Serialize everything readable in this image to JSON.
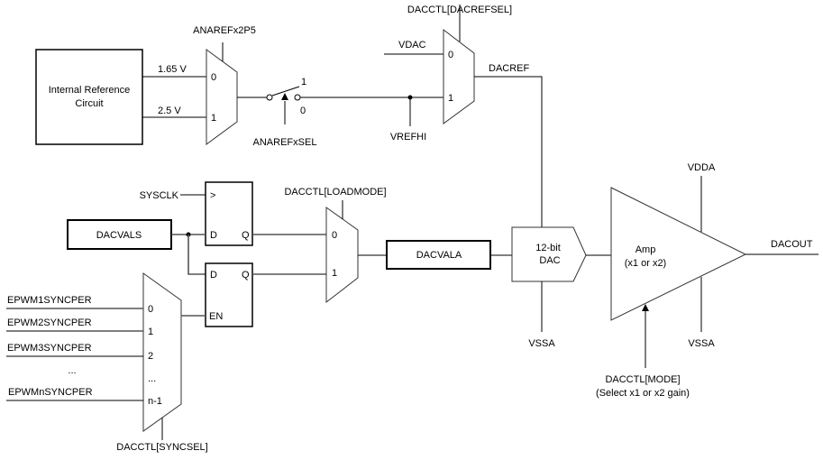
{
  "diagram": {
    "internal_ref": {
      "line1": "Internal Reference",
      "line2": "Circuit"
    },
    "ref_mux": {
      "control": "ANAREFx2P5",
      "in0_label": "1.65 V",
      "in1_label": "2.5 V",
      "port0": "0",
      "port1": "1"
    },
    "ref_switch": {
      "control": "ANAREFxSEL",
      "pos1": "1",
      "pos0": "0"
    },
    "vrefhi": "VREFHI",
    "dacref_mux": {
      "control": "DACCTL[DACREFSEL]",
      "in0_label": "VDAC",
      "port0": "0",
      "port1": "1",
      "output": "DACREF"
    },
    "sysclk": "SYSCLK",
    "dacvals": "DACVALS",
    "ff1": {
      "clk": ">",
      "d": "D",
      "q": "Q"
    },
    "ff2": {
      "d": "D",
      "q": "Q",
      "en": "EN"
    },
    "load_mux": {
      "control": "DACCTL[LOADMODE]",
      "port0": "0",
      "port1": "1"
    },
    "dacvala": "DACVALA",
    "dac": {
      "line1": "12-bit",
      "line2": "DAC",
      "supply_low": "VSSA"
    },
    "amp": {
      "line1": "Amp",
      "line2": "(x1 or x2)",
      "supply_high": "VDDA",
      "supply_low": "VSSA",
      "output": "DACOUT",
      "control_line1": "DACCTL[MODE]",
      "control_line2": "(Select x1 or x2 gain)"
    },
    "sync_mux": {
      "control": "DACCTL[SYNCSEL]",
      "inputs": [
        {
          "label": "EPWM1SYNCPER",
          "port": "0"
        },
        {
          "label": "EPWM2SYNCPER",
          "port": "1"
        },
        {
          "label": "EPWM3SYNCPER",
          "port": "2"
        },
        {
          "label": "...",
          "port": "..."
        },
        {
          "label": "EPWMnSYNCPER",
          "port": "n-1"
        }
      ]
    }
  }
}
